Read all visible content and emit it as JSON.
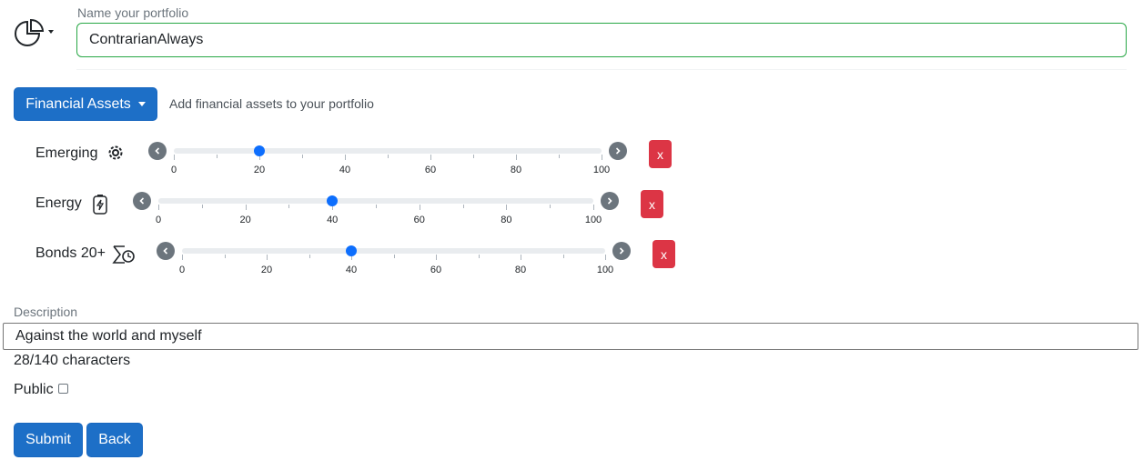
{
  "portfolio": {
    "name_label": "Name your portfolio",
    "name_value": "ContrarianAlways",
    "icon": "pie-chart-icon"
  },
  "assets_menu": {
    "button_label": "Financial Assets",
    "hint": "Add financial assets to your portfolio"
  },
  "assets": [
    {
      "label": "Emerging",
      "icon": "gear-icon",
      "value": 20,
      "delete_label": "x"
    },
    {
      "label": "Energy",
      "icon": "energy-icon",
      "value": 40,
      "delete_label": "x"
    },
    {
      "label": "Bonds 20+",
      "icon": "bonds-clock-icon",
      "value": 40,
      "delete_label": "x"
    }
  ],
  "slider_scale": {
    "min": 0,
    "max": 100,
    "labels": [
      "0",
      "20",
      "40",
      "60",
      "80",
      "100"
    ]
  },
  "description": {
    "label": "Description",
    "value": "Against the world and myself",
    "counter": "28/140 characters"
  },
  "public": {
    "label": "Public",
    "checked": false
  },
  "actions": {
    "submit_label": "Submit",
    "back_label": "Back"
  },
  "colors": {
    "primary": "#1d6fc7",
    "danger": "#dc3545",
    "slider_thumb": "#0d6efd",
    "valid_border": "#28a745"
  }
}
